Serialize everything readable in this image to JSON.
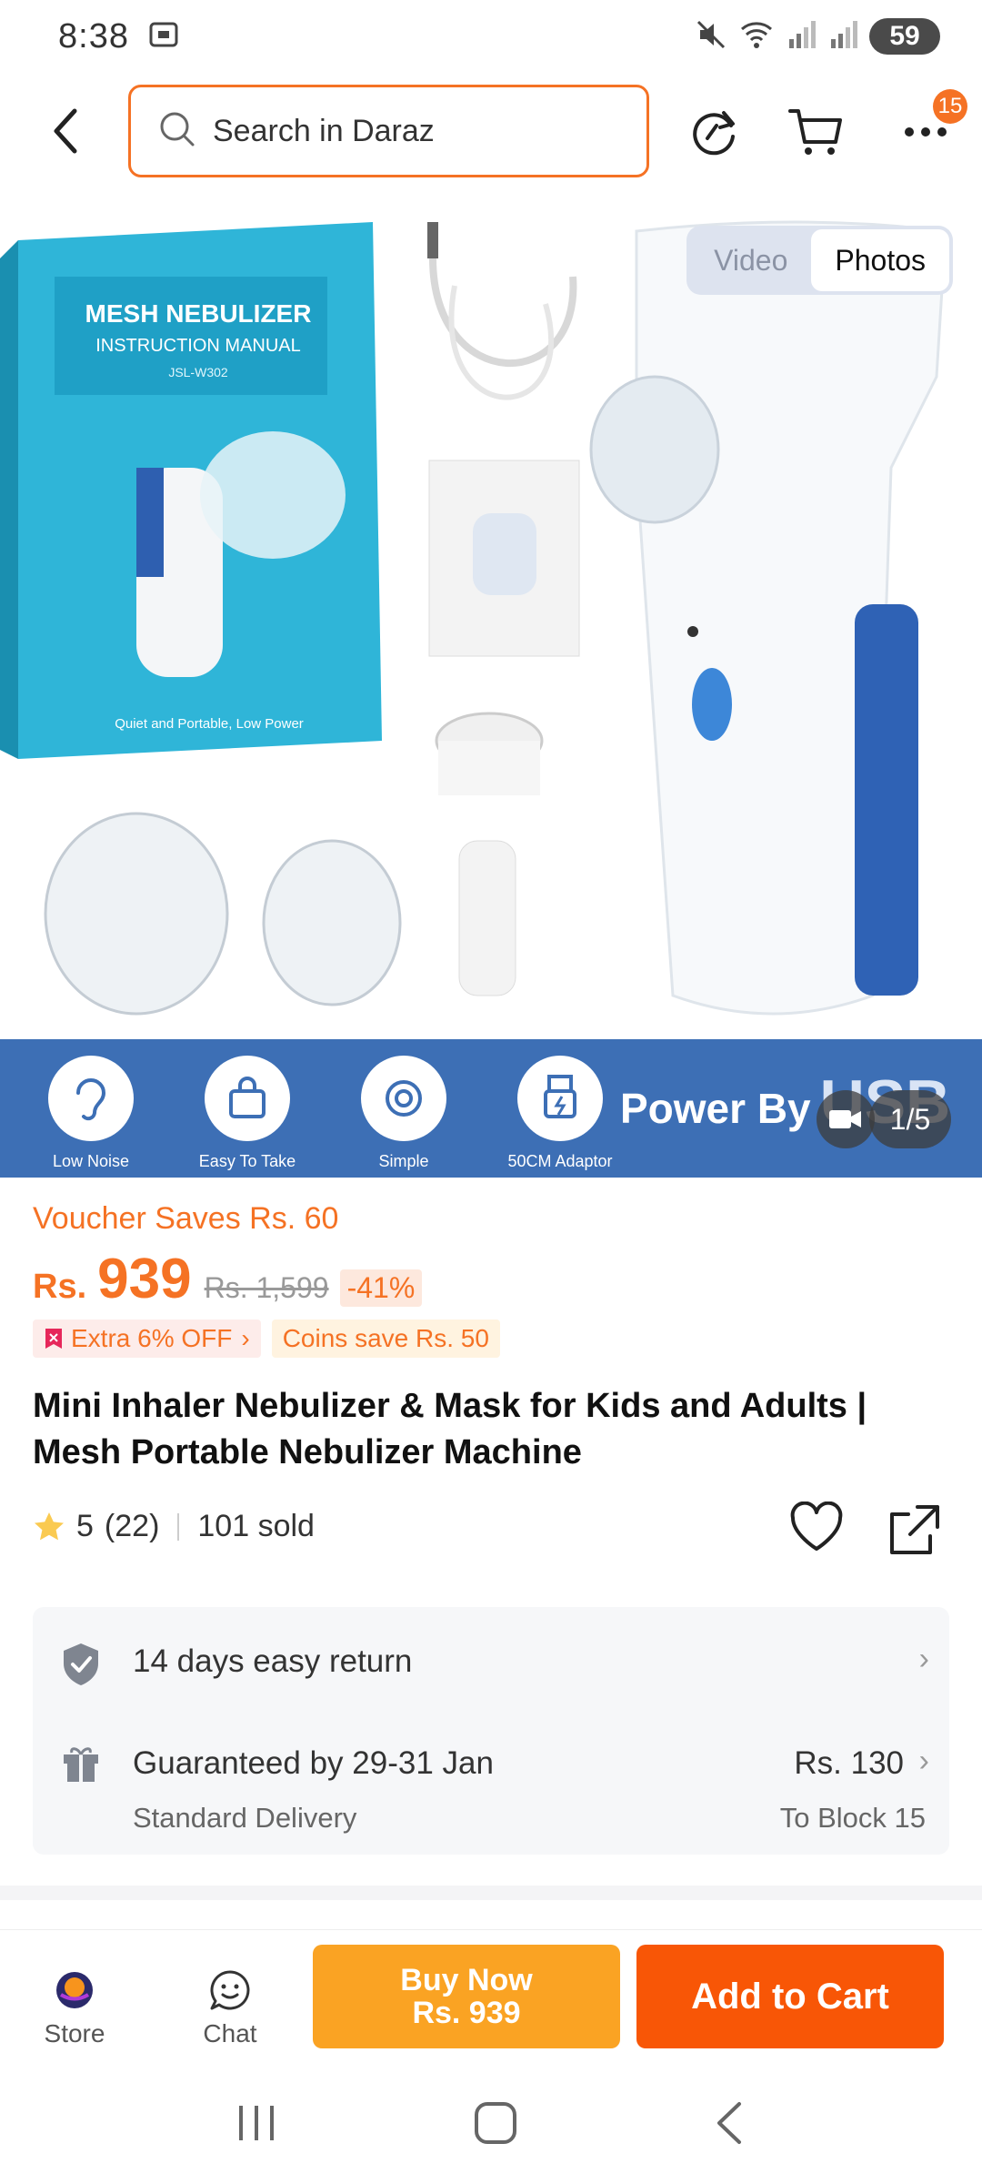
{
  "status": {
    "time": "8:38",
    "battery": "59"
  },
  "header": {
    "search_placeholder": "Search in Daraz",
    "cart_badge": "15"
  },
  "gallery": {
    "tabs": [
      "Video",
      "Photos"
    ],
    "active_tab": "Photos",
    "counter": "1/5",
    "box_title": "MESH NEBULIZER",
    "box_subtitle": "INSTRUCTION MANUAL",
    "box_model": "JSL-W302",
    "box_tagline": "Quiet and Portable, Low Power",
    "features": [
      "Low Noise",
      "Easy To Take",
      "Simple",
      "50CM Adaptor"
    ],
    "power_by": "Power By",
    "usb": "USB"
  },
  "product": {
    "voucher": "Voucher Saves Rs. 60",
    "currency": "Rs.",
    "price": "939",
    "old_price": "Rs. 1,599",
    "discount": "-41%",
    "extra_off": "Extra 6% OFF",
    "coins": "Coins save Rs. 50",
    "title": "Mini Inhaler Nebulizer & Mask for Kids and Adults | Mesh Portable Nebulizer Machine",
    "rating": "5",
    "reviews": "(22)",
    "sold": "101 sold"
  },
  "service": {
    "return": "14 days easy return",
    "delivery": "Guaranteed by 29-31 Jan",
    "delivery_type": "Standard Delivery",
    "delivery_fee": "Rs. 130",
    "delivery_to": "To Block 15"
  },
  "bottom": {
    "store": "Store",
    "chat": "Chat",
    "buy_now": "Buy Now",
    "buy_price": "Rs. 939",
    "add_to_cart": "Add to Cart"
  },
  "colors": {
    "accent": "#f57224",
    "buy": "#faa323",
    "cart": "#f85606",
    "strip": "#3d6fb5"
  }
}
